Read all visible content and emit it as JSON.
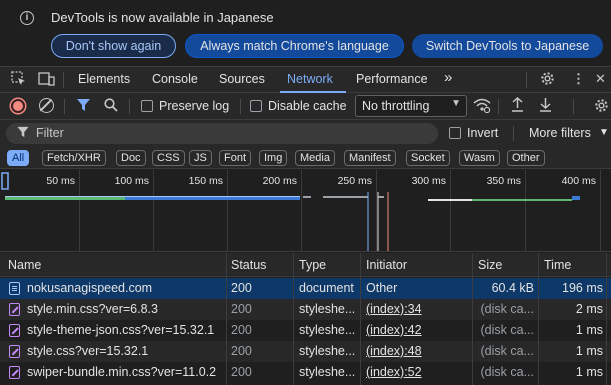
{
  "infobar": {
    "message": "DevTools is now available in Japanese",
    "buttons": [
      "Don't show again",
      "Always match Chrome's language",
      "Switch DevTools to Japanese"
    ],
    "close": "✕"
  },
  "tabs": {
    "items": [
      "Elements",
      "Console",
      "Sources",
      "Network",
      "Performance"
    ],
    "active": "Network",
    "more": "»"
  },
  "toolbar": {
    "preserve_log": "Preserve log",
    "disable_cache": "Disable cache",
    "throttling": "No throttling"
  },
  "filter": {
    "placeholder": "Filter",
    "invert": "Invert",
    "more_filters": "More filters"
  },
  "type_filters": [
    "All",
    "Fetch/XHR",
    "Doc",
    "CSS",
    "JS",
    "Font",
    "Img",
    "Media",
    "Manifest",
    "Socket",
    "Wasm",
    "Other"
  ],
  "timeline": {
    "ticks": [
      "50 ms",
      "100 ms",
      "150 ms",
      "200 ms",
      "250 ms",
      "300 ms",
      "350 ms",
      "400 ms"
    ]
  },
  "table": {
    "columns": [
      "Name",
      "Status",
      "Type",
      "Initiator",
      "Size",
      "Time"
    ],
    "rows": [
      {
        "name": "nokusanagispeed.com",
        "status": "200",
        "type": "document",
        "initiator": "Other",
        "size": "60.4 kB",
        "time": "196 ms",
        "kind": "doc"
      },
      {
        "name": "style.min.css?ver=6.8.3",
        "status": "200",
        "type": "styleshe...",
        "initiator": "(index):34",
        "size": "(disk ca...",
        "time": "2 ms",
        "kind": "css"
      },
      {
        "name": "style-theme-json.css?ver=15.32.1",
        "status": "200",
        "type": "styleshe...",
        "initiator": "(index):42",
        "size": "(disk ca...",
        "time": "1 ms",
        "kind": "css"
      },
      {
        "name": "style.css?ver=15.32.1",
        "status": "200",
        "type": "styleshe...",
        "initiator": "(index):48",
        "size": "(disk ca...",
        "time": "1 ms",
        "kind": "css"
      },
      {
        "name": "swiper-bundle.min.css?ver=11.0.2",
        "status": "200",
        "type": "styleshe...",
        "initiator": "(index):52",
        "size": "(disk ca...",
        "time": "1 ms",
        "kind": "css"
      }
    ]
  },
  "colors": {
    "accent": "#7cacf8",
    "selected_row": "#0e3868",
    "record": "#f28b82"
  }
}
